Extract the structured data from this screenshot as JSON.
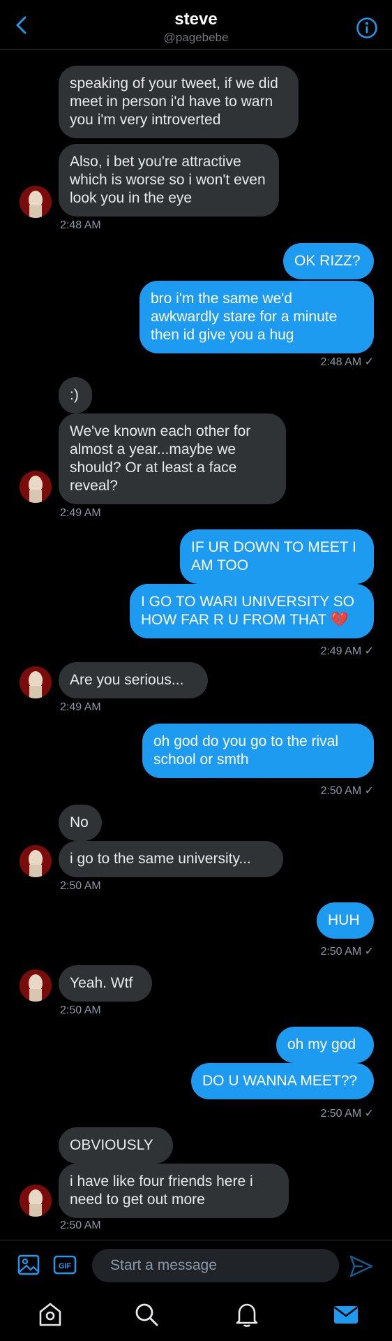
{
  "header": {
    "title": "steve",
    "handle": "@pagebebe"
  },
  "messages": [
    {
      "side": "in",
      "text": "speaking of your tweet, if we did meet in person i'd have to warn you i'm very introverted"
    },
    {
      "side": "in",
      "text": "Also, i bet you're attractive which is worse so i won't even look you in the eye"
    },
    {
      "side": "in-time",
      "text": "2:48 AM"
    },
    {
      "side": "out",
      "text": "OK RIZZ?"
    },
    {
      "side": "out",
      "text": "bro i'm the same we'd awkwardly stare for a minute then id give you a hug"
    },
    {
      "side": "out-time",
      "text": "2:48 AM ✓"
    },
    {
      "side": "in",
      "text": ":)"
    },
    {
      "side": "in",
      "text": "We've known each other for almost a year...maybe we should? Or at least a face reveal?"
    },
    {
      "side": "in-time",
      "text": "2:49 AM"
    },
    {
      "side": "out",
      "text": "IF UR DOWN TO MEET I AM TOO"
    },
    {
      "side": "out",
      "text": "I GO TO WARI UNIVERSITY SO HOW FAR R U FROM THAT 💔"
    },
    {
      "side": "out-time",
      "text": "2:49 AM ✓"
    },
    {
      "side": "in",
      "text": "Are you serious..."
    },
    {
      "side": "in-time",
      "text": "2:49 AM"
    },
    {
      "side": "out",
      "text": "oh god do you go to the rival school or smth"
    },
    {
      "side": "out-time",
      "text": "2:50 AM ✓"
    },
    {
      "side": "in",
      "text": "No"
    },
    {
      "side": "in",
      "text": "i go to the same university..."
    },
    {
      "side": "in-time",
      "text": "2:50 AM"
    },
    {
      "side": "out",
      "text": "HUH"
    },
    {
      "side": "out-time",
      "text": "2:50 AM ✓"
    },
    {
      "side": "in",
      "text": "Yeah. Wtf"
    },
    {
      "side": "in-time",
      "text": "2:50 AM"
    },
    {
      "side": "out",
      "text": "oh my god"
    },
    {
      "side": "out",
      "text": "DO U WANNA MEET??"
    },
    {
      "side": "out-time",
      "text": "2:50 AM ✓"
    },
    {
      "side": "in",
      "text": "OBVIOUSLY"
    },
    {
      "side": "in",
      "text": "i have like four friends here i need to get out more"
    },
    {
      "side": "in-time",
      "text": "2:50 AM"
    }
  ],
  "composer": {
    "placeholder": "Start a message",
    "gif_label": "GIF"
  },
  "colors": {
    "accent": "#1d9bf0",
    "incoming_bubble": "#2f3336",
    "background": "#000000"
  },
  "icons": [
    "back-arrow-icon",
    "info-icon",
    "image-icon",
    "gif-icon",
    "send-icon",
    "home-icon",
    "search-icon",
    "bell-icon",
    "mail-icon"
  ]
}
